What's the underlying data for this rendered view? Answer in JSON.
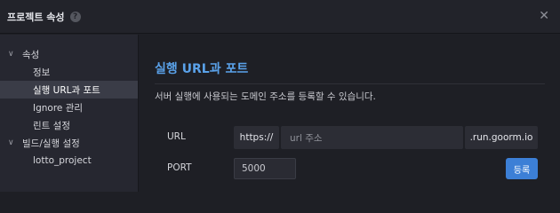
{
  "window": {
    "title": "프로젝트 속성"
  },
  "sidebar": {
    "groups": [
      {
        "label": "속성",
        "items": [
          "정보",
          "실행 URL과 포트",
          "Ignore 관리",
          "린트 설정"
        ]
      },
      {
        "label": "빌드/실행 설정",
        "items": [
          "lotto_project"
        ]
      }
    ],
    "selected": "실행 URL과 포트"
  },
  "main": {
    "title": "실행 URL과 포트",
    "description": "서버 실행에 사용되는 도메인 주소를 등록할 수 있습니다.",
    "url": {
      "label": "URL",
      "prefix": "https://",
      "placeholder": "url 주소",
      "suffix": ".run.goorm.io"
    },
    "port": {
      "label": "PORT",
      "placeholder": "5000",
      "button": "등록"
    }
  },
  "colors": {
    "accent": "#5aa2ea",
    "button": "#3c7fd6",
    "background": "#1e1f25"
  }
}
